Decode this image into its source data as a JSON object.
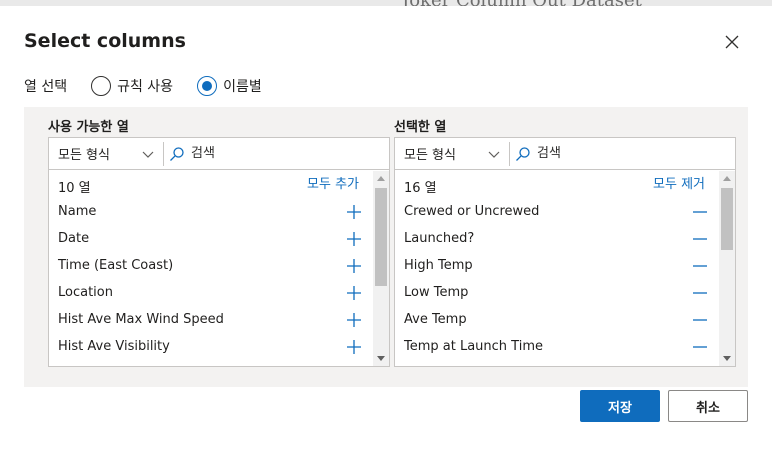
{
  "background": {
    "title_fragment": "Joker Column Out Dataset"
  },
  "dialog": {
    "title": "Select columns",
    "close_icon": "close-icon"
  },
  "column_select": {
    "label": "열 선택",
    "options": [
      {
        "label": "규칙 사용",
        "selected": false
      },
      {
        "label": "이름별",
        "selected": true
      }
    ]
  },
  "available": {
    "title": "사용 가능한 열",
    "filter_type": "모든 형식",
    "search_placeholder": "검색",
    "count": "10 열",
    "bulk_action": "모두 추가",
    "items": [
      {
        "label": "Name",
        "action_icon": "plus-icon"
      },
      {
        "label": "Date",
        "action_icon": "plus-icon"
      },
      {
        "label": "Time (East Coast)",
        "action_icon": "plus-icon"
      },
      {
        "label": "Location",
        "action_icon": "plus-icon"
      },
      {
        "label": "Hist Ave Max Wind Speed",
        "action_icon": "plus-icon"
      },
      {
        "label": "Hist Ave Visibility",
        "action_icon": "plus-icon"
      }
    ]
  },
  "selected": {
    "title": "선택한 열",
    "filter_type": "모든 형식",
    "search_placeholder": "검색",
    "count": "16 열",
    "bulk_action": "모두 제거",
    "items": [
      {
        "label": "Crewed or Uncrewed",
        "action_icon": "minus-icon"
      },
      {
        "label": "Launched?",
        "action_icon": "minus-icon"
      },
      {
        "label": "High Temp",
        "action_icon": "minus-icon"
      },
      {
        "label": "Low Temp",
        "action_icon": "minus-icon"
      },
      {
        "label": "Ave Temp",
        "action_icon": "minus-icon"
      },
      {
        "label": "Temp at Launch Time",
        "action_icon": "minus-icon"
      }
    ]
  },
  "footer": {
    "save_label": "저장",
    "cancel_label": "취소"
  },
  "colors": {
    "accent": "#0f6cbd",
    "panel_background": "#f3f2f1",
    "border": "#c8c6c4"
  }
}
